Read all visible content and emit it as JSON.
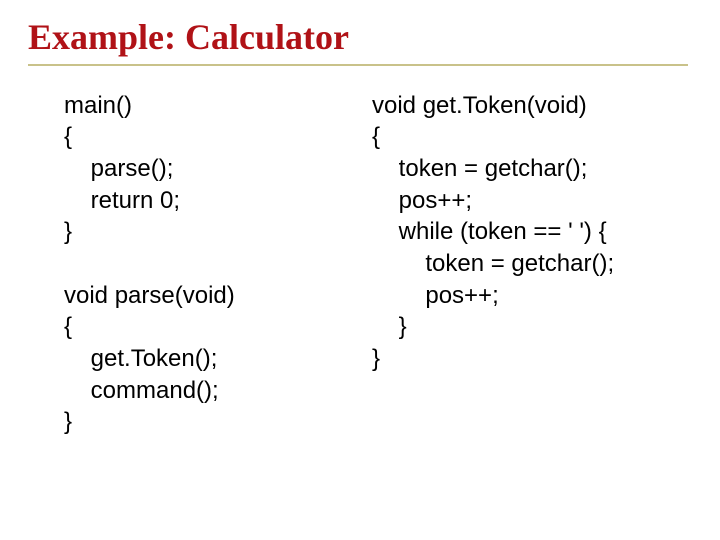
{
  "title": "Example: Calculator",
  "left_code": "main()\n{\n    parse();\n    return 0;\n}\n\nvoid parse(void)\n{\n    get.Token();\n    command();\n}",
  "right_code": "void get.Token(void)\n{\n    token = getchar();\n    pos++;\n    while (token == ' ') {\n        token = getchar();\n        pos++;\n    }\n}"
}
